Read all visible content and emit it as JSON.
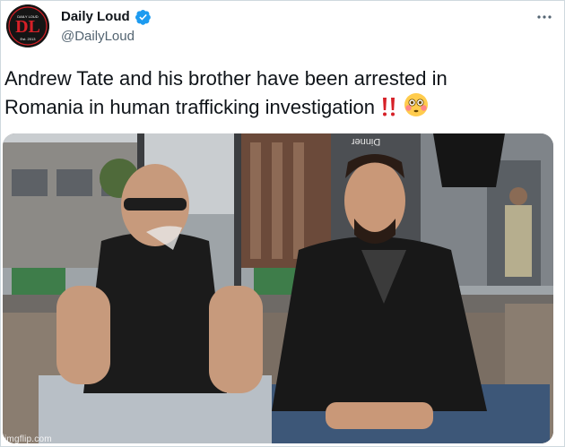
{
  "tweet": {
    "author": {
      "display_name": "Daily Loud",
      "handle": "@DailyLoud",
      "verified": true,
      "avatar_icon": "daily-loud-logo",
      "avatar_logo_text": "DL",
      "avatar_small_text": "DAILY LOUD",
      "avatar_est_text": "Est. 2013"
    },
    "more_icon": "more-horizontal-icon",
    "text_line_1": "Andrew Tate and his brother have been arrested in",
    "text_line_2": "Romania in human trafficking investigation",
    "emojis": [
      "double-exclamation-icon",
      "flushed-face-icon"
    ],
    "media": {
      "description_icon": "photo-two-men-seated-on-sofa",
      "sign_text": "Dinner"
    }
  },
  "watermark": "imgflip.com",
  "colors": {
    "text_primary": "#0f1419",
    "text_secondary": "#536471",
    "verified_blue": "#1d9bf0",
    "brand_red": "#d62027"
  }
}
